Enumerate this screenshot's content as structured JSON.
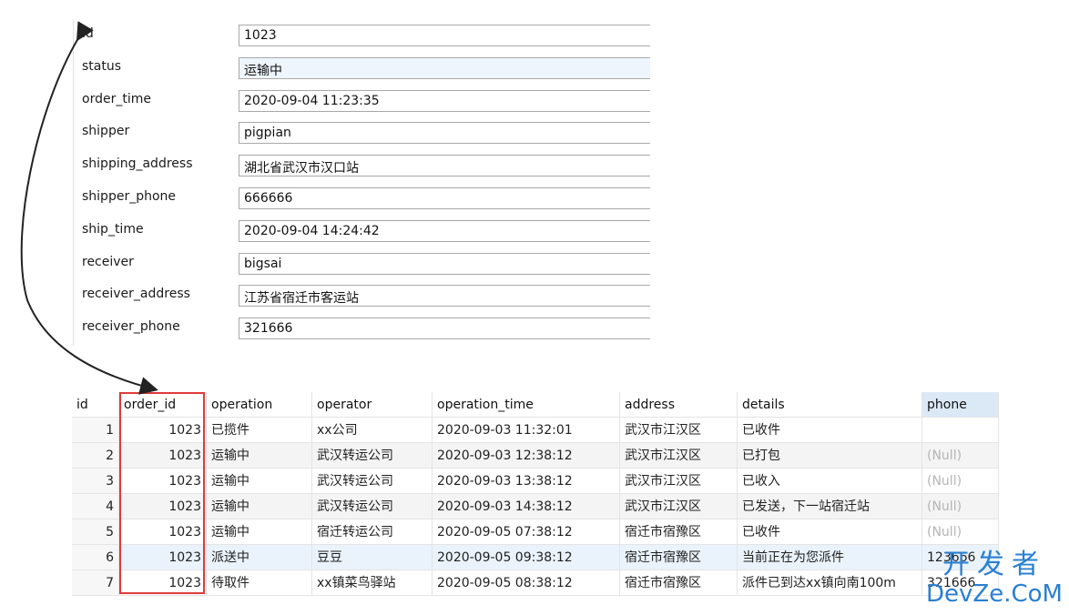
{
  "record_form": {
    "fields": [
      {
        "label": "id",
        "value": "1023"
      },
      {
        "label": "status",
        "value": "运输中"
      },
      {
        "label": "order_time",
        "value": "2020-09-04 11:23:35"
      },
      {
        "label": "shipper",
        "value": "pigpian"
      },
      {
        "label": "shipping_address",
        "value": "湖北省武汉市汉口站"
      },
      {
        "label": "shipper_phone",
        "value": "666666"
      },
      {
        "label": "ship_time",
        "value": "2020-09-04 14:24:42"
      },
      {
        "label": "receiver",
        "value": "bigsai"
      },
      {
        "label": "receiver_address",
        "value": "江苏省宿迁市客运站"
      },
      {
        "label": "receiver_phone",
        "value": "321666"
      }
    ]
  },
  "logistics_table": {
    "columns": [
      "id",
      "order_id",
      "operation",
      "operator",
      "operation_time",
      "address",
      "details",
      "phone"
    ],
    "rows": [
      [
        "1",
        "1023",
        "已揽件",
        "xx公司",
        "2020-09-03 11:32:01",
        "武汉市江汉区",
        "已收件",
        ""
      ],
      [
        "2",
        "1023",
        "运输中",
        "武汉转运公司",
        "2020-09-03 12:38:12",
        "武汉市江汉区",
        "已打包",
        "(Null)"
      ],
      [
        "3",
        "1023",
        "运输中",
        "武汉转运公司",
        "2020-09-03 13:38:12",
        "武汉市江汉区",
        "已收入",
        "(Null)"
      ],
      [
        "4",
        "1023",
        "运输中",
        "武汉转运公司",
        "2020-09-03 14:38:12",
        "武汉市江汉区",
        "已发送，下一站宿迁站",
        "(Null)"
      ],
      [
        "5",
        "1023",
        "运输中",
        "宿迁转运公司",
        "2020-09-05 07:38:12",
        "宿迁市宿豫区",
        "已收件",
        "(Null)"
      ],
      [
        "6",
        "1023",
        "派送中",
        "豆豆",
        "2020-09-05 09:38:12",
        "宿迁市宿豫区",
        "当前正在为您派件",
        "123666"
      ],
      [
        "7",
        "1023",
        "待取件",
        "xx镇菜鸟驿站",
        "2020-09-05 08:38:12",
        "宿迁市宿豫区",
        "派件已到达xx镇向南100m",
        "321666"
      ]
    ]
  },
  "watermark": {
    "top": "开发者",
    "bottom": "DevZe.CoM"
  },
  "colors": {
    "highlight_box": "#e03a3a",
    "watermark": "#2a7fd2",
    "selected_row": "#eaf3fb",
    "phone_header": "#dbe9f7"
  },
  "icons": {
    "relation_arrow": "curved-double-arrow-icon"
  }
}
